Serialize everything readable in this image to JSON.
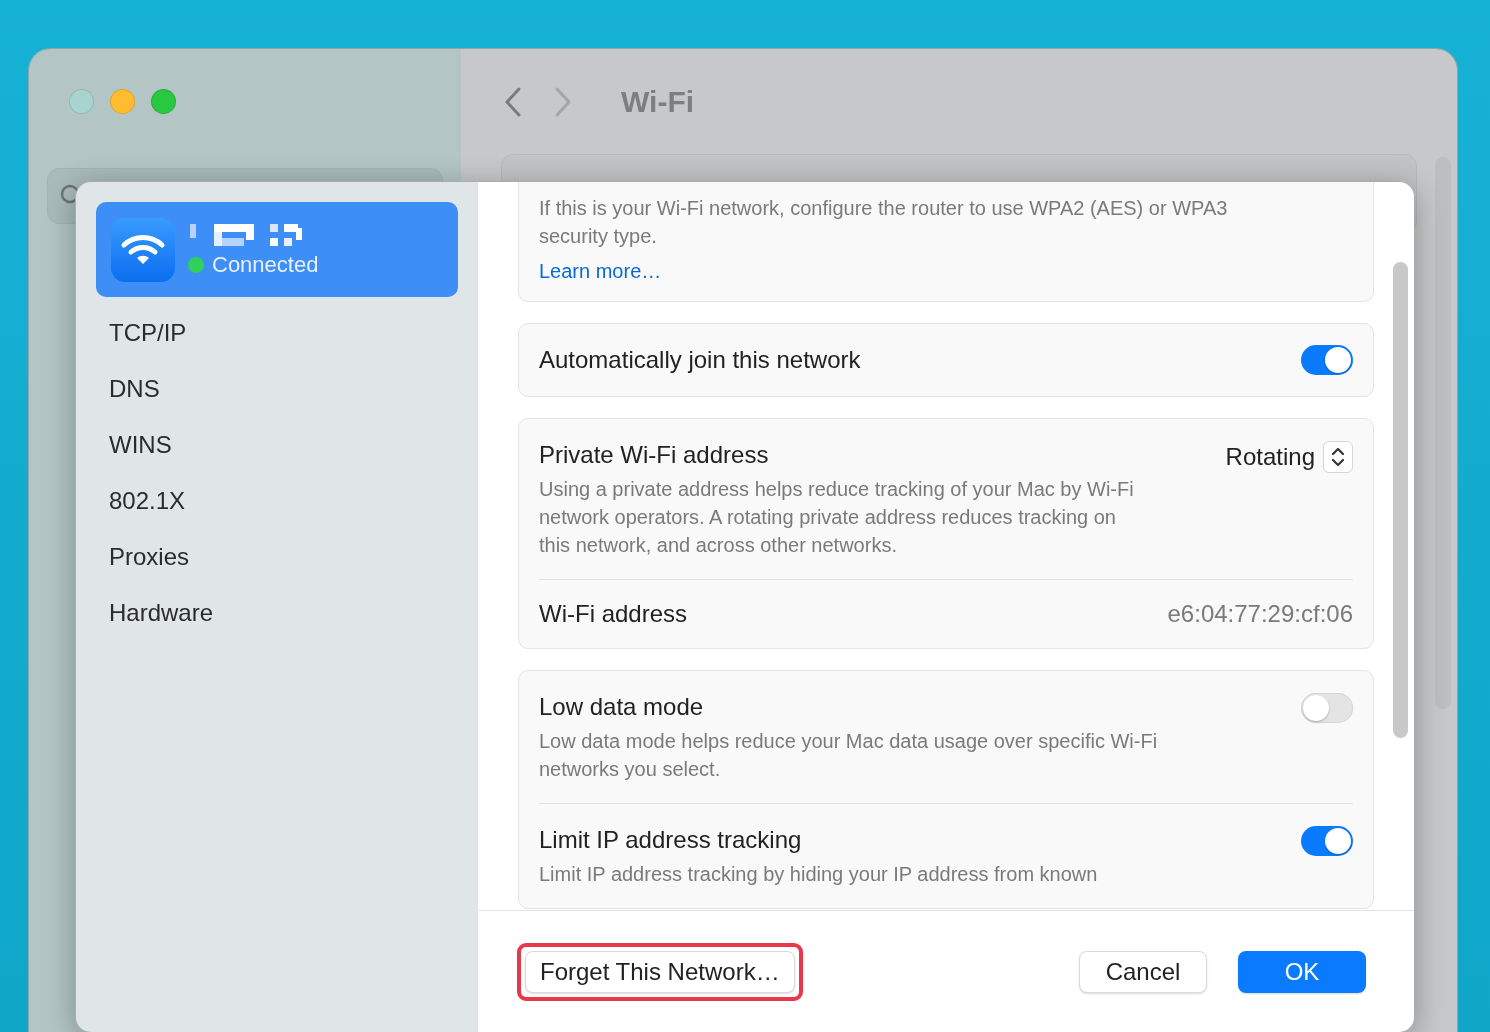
{
  "window": {
    "traffic_lights": [
      {
        "color": "#a7d3d0"
      },
      {
        "color": "#febc2e"
      },
      {
        "color": "#28c840"
      }
    ],
    "nav": [
      {
        "kind": "back",
        "disabled": false
      },
      {
        "kind": "forward",
        "disabled": true
      }
    ],
    "title": "Wi-Fi"
  },
  "sheet": {
    "network": {
      "status": "Connected",
      "connected": true,
      "selected": true
    },
    "sidebar_items": [
      {
        "label": "TCP/IP",
        "selected": false
      },
      {
        "label": "DNS",
        "selected": false
      },
      {
        "label": "WINS",
        "selected": false
      },
      {
        "label": "802.1X",
        "selected": false
      },
      {
        "label": "Proxies",
        "selected": false
      },
      {
        "label": "Hardware",
        "selected": false
      }
    ],
    "cards": [
      {
        "rows": [
          {
            "kind": "notice",
            "text": "If this is your Wi-Fi network, configure the router to use WPA2 (AES) or WPA3 security type.",
            "link": "Learn more…"
          }
        ]
      },
      {
        "rows": [
          {
            "kind": "toggle",
            "label": "Automatically join this network",
            "on": true
          }
        ]
      },
      {
        "rows": [
          {
            "kind": "popup",
            "label": "Private Wi-Fi address",
            "value": "Rotating",
            "description": "Using a private address helps reduce tracking of your Mac by Wi-Fi network operators. A rotating private address reduces tracking on this network, and across other networks."
          },
          {
            "kind": "value",
            "label": "Wi-Fi address",
            "value": "e6:04:77:29:cf:06"
          }
        ]
      },
      {
        "rows": [
          {
            "kind": "toggle",
            "label": "Low data mode",
            "on": false,
            "description": "Low data mode helps reduce your Mac data usage over specific Wi-Fi networks you select."
          },
          {
            "kind": "toggle",
            "label": "Limit IP address tracking",
            "on": true,
            "description": "Limit IP address tracking by hiding your IP address from known"
          }
        ]
      }
    ],
    "footer": {
      "leading_buttons": [
        {
          "kind": "secondary",
          "label": "Forget This Network…",
          "highlighted": true
        }
      ],
      "trailing_buttons": [
        {
          "kind": "secondary",
          "label": "Cancel",
          "highlighted": false
        },
        {
          "kind": "primary",
          "label": "OK",
          "highlighted": false
        }
      ]
    }
  }
}
